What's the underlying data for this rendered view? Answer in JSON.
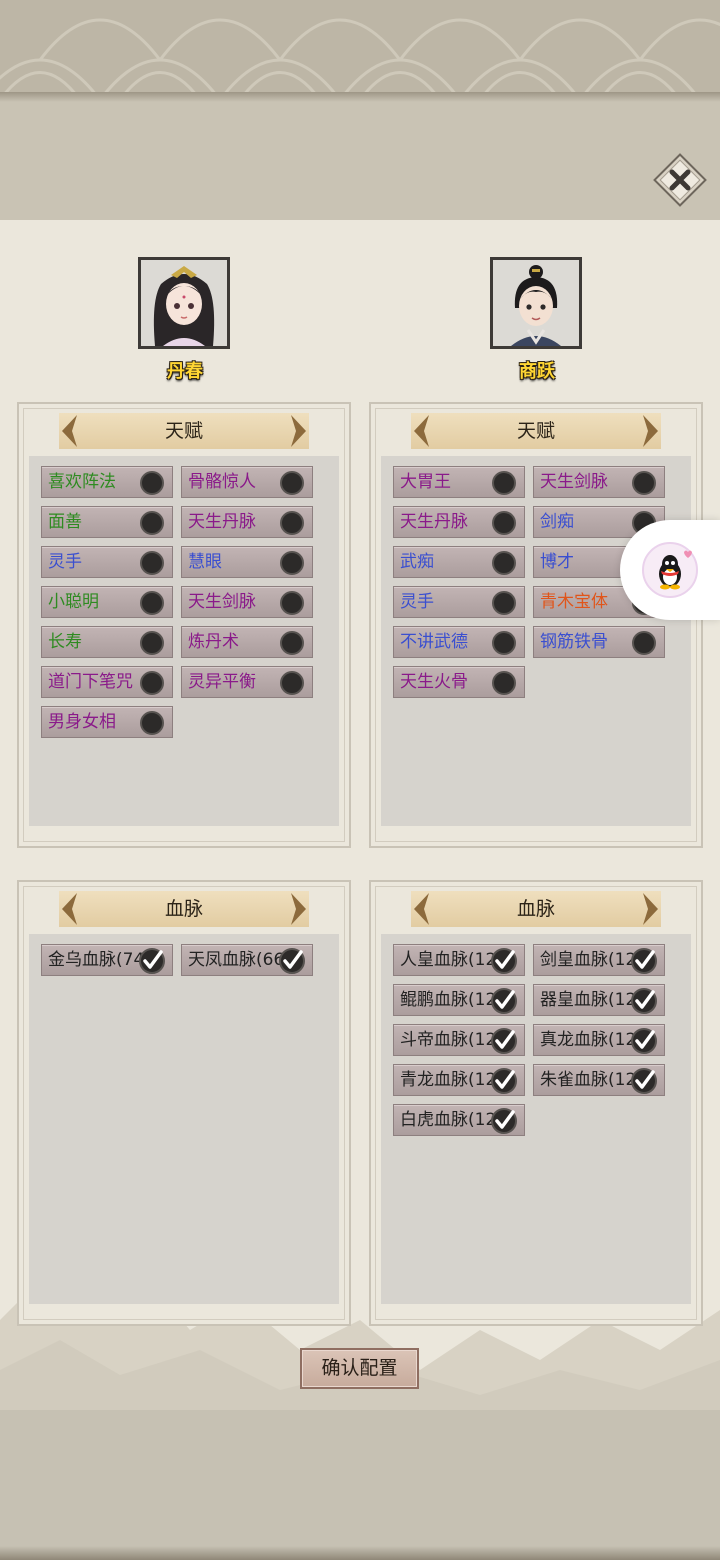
{
  "characters": [
    {
      "name": "丹春"
    },
    {
      "name": "商跃"
    }
  ],
  "talent_panels": [
    {
      "title": "天赋",
      "items": [
        {
          "label": "喜欢阵法",
          "color": "#2e8b21"
        },
        {
          "label": "骨骼惊人",
          "color": "#8a1a8a"
        },
        {
          "label": "面善",
          "color": "#2e8b21"
        },
        {
          "label": "天生丹脉",
          "color": "#8a1a8a"
        },
        {
          "label": "灵手",
          "color": "#3a4fd0"
        },
        {
          "label": "慧眼",
          "color": "#3a4fd0"
        },
        {
          "label": "小聪明",
          "color": "#2e8b21"
        },
        {
          "label": "天生剑脉",
          "color": "#8a1a8a"
        },
        {
          "label": "长寿",
          "color": "#2e8b21"
        },
        {
          "label": "炼丹术",
          "color": "#8a1a8a"
        },
        {
          "label": "道门下笔咒",
          "color": "#8a1a8a"
        },
        {
          "label": "灵异平衡",
          "color": "#8a1a8a"
        },
        {
          "label": "男身女相",
          "color": "#8a1a8a"
        }
      ]
    },
    {
      "title": "天赋",
      "items": [
        {
          "label": "大胃王",
          "color": "#8a1a8a"
        },
        {
          "label": "天生剑脉",
          "color": "#8a1a8a"
        },
        {
          "label": "天生丹脉",
          "color": "#8a1a8a"
        },
        {
          "label": "剑痴",
          "color": "#3a4fd0"
        },
        {
          "label": "武痴",
          "color": "#3a4fd0"
        },
        {
          "label": "博才",
          "color": "#3a4fd0"
        },
        {
          "label": "灵手",
          "color": "#3a4fd0"
        },
        {
          "label": "青木宝体",
          "color": "#e0551a"
        },
        {
          "label": "不讲武德",
          "color": "#3a4fd0"
        },
        {
          "label": "钢筋铁骨",
          "color": "#3a4fd0"
        },
        {
          "label": "天生火骨",
          "color": "#8a1a8a"
        }
      ]
    }
  ],
  "bloodline_panels": [
    {
      "title": "血脉",
      "items": [
        {
          "label": "金乌血脉(74"
        },
        {
          "label": "天凤血脉(66"
        }
      ]
    },
    {
      "title": "血脉",
      "items": [
        {
          "label": "人皇血脉(12"
        },
        {
          "label": "剑皇血脉(12"
        },
        {
          "label": "鲲鹏血脉(12"
        },
        {
          "label": "器皇血脉(12"
        },
        {
          "label": "斗帝血脉(12"
        },
        {
          "label": "真龙血脉(12"
        },
        {
          "label": "青龙血脉(12"
        },
        {
          "label": "朱雀血脉(12"
        },
        {
          "label": "白虎血脉(12"
        }
      ]
    }
  ],
  "confirm_label": "确认配置",
  "icons": {
    "close": "close-icon",
    "float": "qq-penguin-icon",
    "talent_marker": "dot-icon",
    "bloodline_marker": "checkmark-icon"
  }
}
